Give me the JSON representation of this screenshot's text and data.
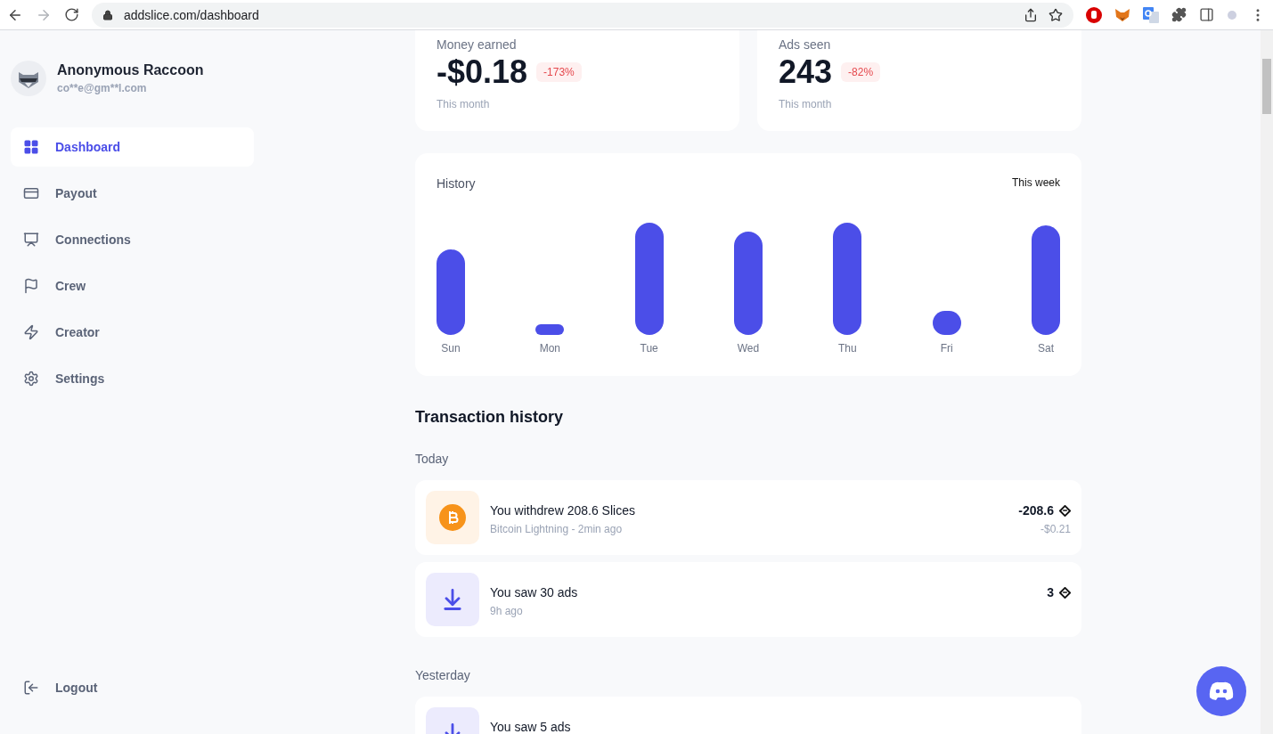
{
  "browser": {
    "url": "addslice.com/dashboard"
  },
  "profile": {
    "name": "Anonymous Raccoon",
    "email": "co**e@gm**l.com"
  },
  "nav": [
    {
      "kind": "grid",
      "label": "Dashboard",
      "selected": true
    },
    {
      "kind": "card",
      "label": "Payout",
      "selected": false
    },
    {
      "kind": "screen",
      "label": "Connections",
      "selected": false
    },
    {
      "kind": "flag",
      "label": "Crew",
      "selected": false
    },
    {
      "kind": "bolt",
      "label": "Creator",
      "selected": false
    },
    {
      "kind": "gear",
      "label": "Settings",
      "selected": false
    }
  ],
  "logout": {
    "label": "Logout"
  },
  "stats": [
    {
      "label": "Money earned",
      "value": "-$0.18",
      "change": "-173%",
      "period": "This month"
    },
    {
      "label": "Ads seen",
      "value": "243",
      "change": "-82%",
      "period": "This month"
    }
  ],
  "history": {
    "title": "History",
    "range": "This week",
    "days": [
      "Sun",
      "Mon",
      "Tue",
      "Wed",
      "Thu",
      "Fri",
      "Sat"
    ]
  },
  "transactions": {
    "title": "Transaction history",
    "groups": [
      {
        "label": "Today",
        "items": [
          {
            "kind": "bitcoin",
            "title": "You withdrew 208.6 Slices",
            "subtitle": "Bitcoin Lightning - 2min ago",
            "amount": "-208.6",
            "fiat": "-$0.21"
          },
          {
            "kind": "ads",
            "title": "You saw 30 ads",
            "subtitle": "9h ago",
            "amount": "3"
          }
        ]
      },
      {
        "label": "Yesterday",
        "items": [
          {
            "kind": "ads",
            "title": "You saw 5 ads"
          }
        ]
      }
    ]
  }
}
